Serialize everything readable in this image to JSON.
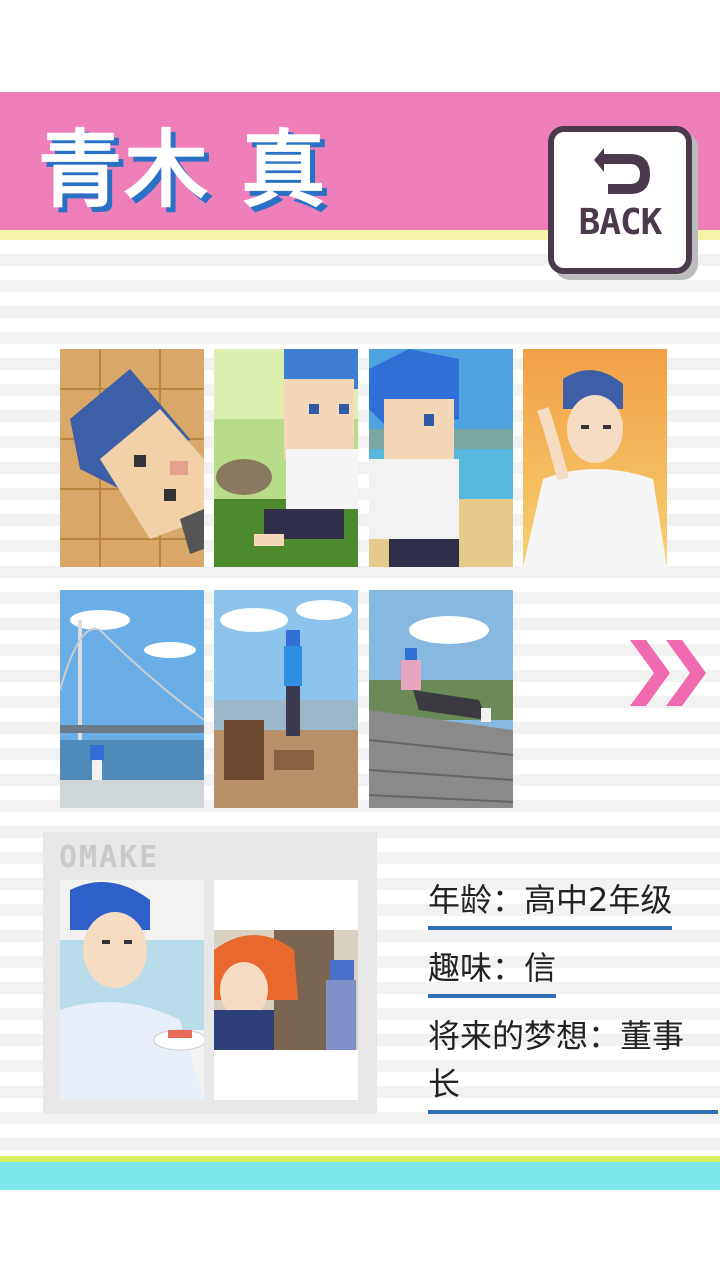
{
  "header": {
    "title": "青木 真",
    "back_label": "BACK",
    "bg_color": "#ef7fb8",
    "title_shadow_color": "#2a70c7"
  },
  "gallery": {
    "row1": [
      "pixel-art-lying-on-floor",
      "pixel-art-with-cat-on-grass",
      "pixel-art-on-beach",
      "anime-portrait-sunset"
    ],
    "row2": [
      "bridge-photo-with-pixel-character",
      "observatory-photo-with-character",
      "boardwalk-photo-with-character"
    ],
    "next_icon": "double-chevron-right-icon"
  },
  "omake": {
    "label": "OMAKE",
    "images": [
      "eating-sushi-illustration",
      "red-hair-boy-illustration"
    ]
  },
  "profile": {
    "age": "年龄：高中2年级",
    "hobby": "趣味：信",
    "dream_line1": "将来的梦想：董事",
    "dream_line2": "长",
    "underline_color": "#2f6fb6"
  }
}
